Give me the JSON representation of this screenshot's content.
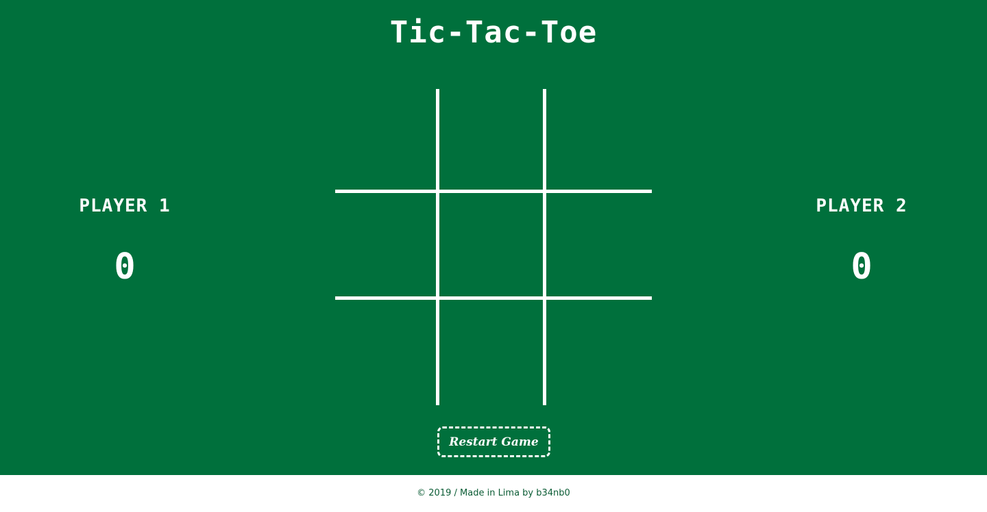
{
  "title": "Tic-Tac-Toe",
  "players": [
    {
      "name": "PLAYER 1",
      "score": "0"
    },
    {
      "name": "PLAYER 2",
      "score": "0"
    }
  ],
  "board": {
    "cells": [
      "",
      "",
      "",
      "",
      "",
      "",
      "",
      "",
      ""
    ]
  },
  "restart_label": "Restart Game",
  "footer": "© 2019 / Made in Lima by b34nb0",
  "colors": {
    "background": "#00703c",
    "foreground": "#ffffff",
    "footer_text": "#0b5c35"
  }
}
